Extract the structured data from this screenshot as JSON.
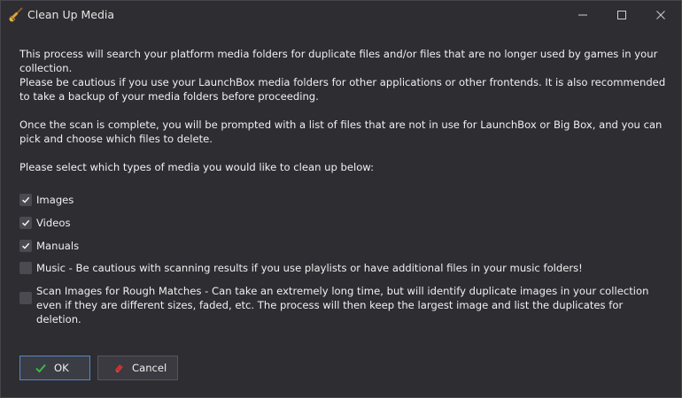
{
  "window": {
    "title": "Clean Up Media"
  },
  "intro": {
    "paragraph1": "This process will search your platform media folders for duplicate files and/or files that are no longer used by games in your collection.",
    "paragraph2": "Please be cautious if you use your LaunchBox media folders for other applications or other frontends. It is also recommended to take a backup of your media folders before proceeding.",
    "paragraph3": "Once the scan is complete, you will be prompted with a list of files that are not in use for LaunchBox or Big Box, and you can pick and choose which files to delete.",
    "paragraph4": "Please select which types of media you would like to clean up below:"
  },
  "options": [
    {
      "label": "Images",
      "checked": true
    },
    {
      "label": "Videos",
      "checked": true
    },
    {
      "label": "Manuals",
      "checked": true
    },
    {
      "label": "Music - Be cautious with scanning results if you use playlists or have additional files in your music folders!",
      "checked": false
    },
    {
      "label": "Scan Images for Rough Matches - Can take an extremely long time, but will identify duplicate images in your collection even if they are different sizes, faded, etc. The process will then keep the largest image and list the duplicates for deletion.",
      "checked": false
    }
  ],
  "buttons": {
    "ok_label": "OK",
    "cancel_label": "Cancel"
  },
  "icons": {
    "app": "broom-icon",
    "ok": "checkmark-icon",
    "cancel": "eraser-icon"
  },
  "colors": {
    "background": "#2d2d32",
    "ok_check": "#3fbf4a",
    "cancel_icon": "#d23a3a",
    "ok_border": "#5a86c8"
  }
}
